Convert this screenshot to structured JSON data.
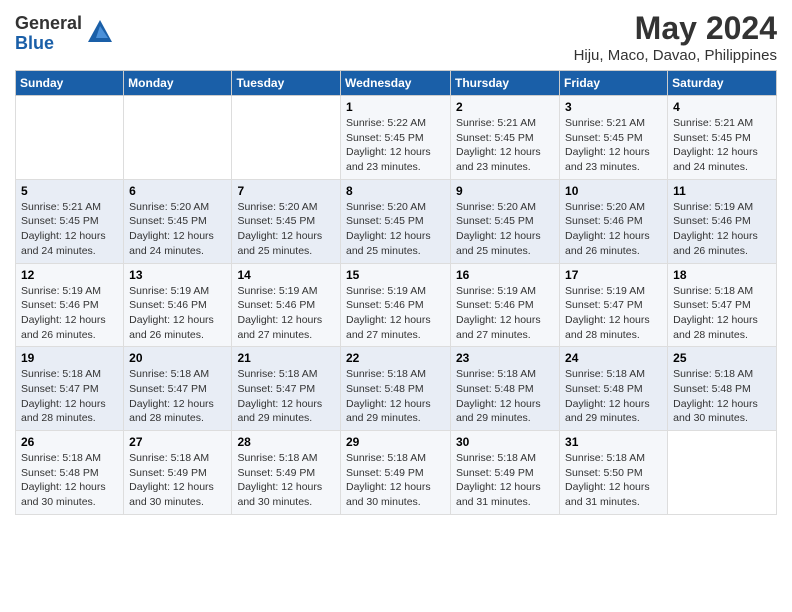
{
  "logo": {
    "general": "General",
    "blue": "Blue"
  },
  "header": {
    "title": "May 2024",
    "subtitle": "Hiju, Maco, Davao, Philippines"
  },
  "weekdays": [
    "Sunday",
    "Monday",
    "Tuesday",
    "Wednesday",
    "Thursday",
    "Friday",
    "Saturday"
  ],
  "weeks": [
    [
      {
        "day": "",
        "detail": ""
      },
      {
        "day": "",
        "detail": ""
      },
      {
        "day": "",
        "detail": ""
      },
      {
        "day": "1",
        "detail": "Sunrise: 5:22 AM\nSunset: 5:45 PM\nDaylight: 12 hours\nand 23 minutes."
      },
      {
        "day": "2",
        "detail": "Sunrise: 5:21 AM\nSunset: 5:45 PM\nDaylight: 12 hours\nand 23 minutes."
      },
      {
        "day": "3",
        "detail": "Sunrise: 5:21 AM\nSunset: 5:45 PM\nDaylight: 12 hours\nand 23 minutes."
      },
      {
        "day": "4",
        "detail": "Sunrise: 5:21 AM\nSunset: 5:45 PM\nDaylight: 12 hours\nand 24 minutes."
      }
    ],
    [
      {
        "day": "5",
        "detail": "Sunrise: 5:21 AM\nSunset: 5:45 PM\nDaylight: 12 hours\nand 24 minutes."
      },
      {
        "day": "6",
        "detail": "Sunrise: 5:20 AM\nSunset: 5:45 PM\nDaylight: 12 hours\nand 24 minutes."
      },
      {
        "day": "7",
        "detail": "Sunrise: 5:20 AM\nSunset: 5:45 PM\nDaylight: 12 hours\nand 25 minutes."
      },
      {
        "day": "8",
        "detail": "Sunrise: 5:20 AM\nSunset: 5:45 PM\nDaylight: 12 hours\nand 25 minutes."
      },
      {
        "day": "9",
        "detail": "Sunrise: 5:20 AM\nSunset: 5:45 PM\nDaylight: 12 hours\nand 25 minutes."
      },
      {
        "day": "10",
        "detail": "Sunrise: 5:20 AM\nSunset: 5:46 PM\nDaylight: 12 hours\nand 26 minutes."
      },
      {
        "day": "11",
        "detail": "Sunrise: 5:19 AM\nSunset: 5:46 PM\nDaylight: 12 hours\nand 26 minutes."
      }
    ],
    [
      {
        "day": "12",
        "detail": "Sunrise: 5:19 AM\nSunset: 5:46 PM\nDaylight: 12 hours\nand 26 minutes."
      },
      {
        "day": "13",
        "detail": "Sunrise: 5:19 AM\nSunset: 5:46 PM\nDaylight: 12 hours\nand 26 minutes."
      },
      {
        "day": "14",
        "detail": "Sunrise: 5:19 AM\nSunset: 5:46 PM\nDaylight: 12 hours\nand 27 minutes."
      },
      {
        "day": "15",
        "detail": "Sunrise: 5:19 AM\nSunset: 5:46 PM\nDaylight: 12 hours\nand 27 minutes."
      },
      {
        "day": "16",
        "detail": "Sunrise: 5:19 AM\nSunset: 5:46 PM\nDaylight: 12 hours\nand 27 minutes."
      },
      {
        "day": "17",
        "detail": "Sunrise: 5:19 AM\nSunset: 5:47 PM\nDaylight: 12 hours\nand 28 minutes."
      },
      {
        "day": "18",
        "detail": "Sunrise: 5:18 AM\nSunset: 5:47 PM\nDaylight: 12 hours\nand 28 minutes."
      }
    ],
    [
      {
        "day": "19",
        "detail": "Sunrise: 5:18 AM\nSunset: 5:47 PM\nDaylight: 12 hours\nand 28 minutes."
      },
      {
        "day": "20",
        "detail": "Sunrise: 5:18 AM\nSunset: 5:47 PM\nDaylight: 12 hours\nand 28 minutes."
      },
      {
        "day": "21",
        "detail": "Sunrise: 5:18 AM\nSunset: 5:47 PM\nDaylight: 12 hours\nand 29 minutes."
      },
      {
        "day": "22",
        "detail": "Sunrise: 5:18 AM\nSunset: 5:48 PM\nDaylight: 12 hours\nand 29 minutes."
      },
      {
        "day": "23",
        "detail": "Sunrise: 5:18 AM\nSunset: 5:48 PM\nDaylight: 12 hours\nand 29 minutes."
      },
      {
        "day": "24",
        "detail": "Sunrise: 5:18 AM\nSunset: 5:48 PM\nDaylight: 12 hours\nand 29 minutes."
      },
      {
        "day": "25",
        "detail": "Sunrise: 5:18 AM\nSunset: 5:48 PM\nDaylight: 12 hours\nand 30 minutes."
      }
    ],
    [
      {
        "day": "26",
        "detail": "Sunrise: 5:18 AM\nSunset: 5:48 PM\nDaylight: 12 hours\nand 30 minutes."
      },
      {
        "day": "27",
        "detail": "Sunrise: 5:18 AM\nSunset: 5:49 PM\nDaylight: 12 hours\nand 30 minutes."
      },
      {
        "day": "28",
        "detail": "Sunrise: 5:18 AM\nSunset: 5:49 PM\nDaylight: 12 hours\nand 30 minutes."
      },
      {
        "day": "29",
        "detail": "Sunrise: 5:18 AM\nSunset: 5:49 PM\nDaylight: 12 hours\nand 30 minutes."
      },
      {
        "day": "30",
        "detail": "Sunrise: 5:18 AM\nSunset: 5:49 PM\nDaylight: 12 hours\nand 31 minutes."
      },
      {
        "day": "31",
        "detail": "Sunrise: 5:18 AM\nSunset: 5:50 PM\nDaylight: 12 hours\nand 31 minutes."
      },
      {
        "day": "",
        "detail": ""
      }
    ]
  ]
}
